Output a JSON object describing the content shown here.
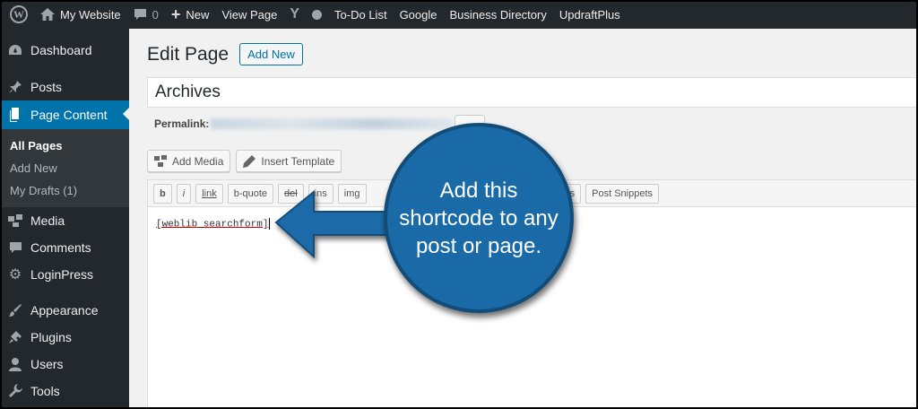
{
  "admin_bar": {
    "site_name": "My Website",
    "comments_count": "0",
    "new_label": "New",
    "view_page": "View Page",
    "links": [
      "To-Do List",
      "Google",
      "Business Directory",
      "UpdraftPlus"
    ]
  },
  "sidebar": {
    "items": [
      {
        "label": "Dashboard",
        "icon": "dashboard-icon"
      },
      {
        "label": "Posts",
        "icon": "pin-icon"
      },
      {
        "label": "Page Content",
        "icon": "pages-icon"
      }
    ],
    "submenu": [
      "All Pages",
      "Add New",
      "My Drafts (1)"
    ],
    "items_after": [
      {
        "label": "Media",
        "icon": "media-icon"
      },
      {
        "label": "Comments",
        "icon": "comment-icon"
      },
      {
        "label": "LoginPress",
        "icon": "gear-icon"
      },
      {
        "label": "Appearance",
        "icon": "brush-icon"
      },
      {
        "label": "Plugins",
        "icon": "plugin-icon"
      },
      {
        "label": "Users",
        "icon": "user-icon"
      },
      {
        "label": "Tools",
        "icon": "wrench-icon"
      }
    ]
  },
  "main": {
    "page_title": "Edit Page",
    "add_new": "Add New",
    "post_title": "Archives",
    "permalink_label": "Permalink:",
    "add_media": "Add Media",
    "insert_template": "Insert Template",
    "quicktags": [
      "b",
      "i",
      "link",
      "b-quote",
      "del",
      "ins",
      "img"
    ],
    "quicktags_tail": [
      "gs",
      "Post Snippets"
    ],
    "content": "[weblib_searchform]"
  },
  "callout": {
    "text": "Add this shortcode to any post or page."
  },
  "colors": {
    "admin_dark": "#23282d",
    "accent_blue": "#0073aa",
    "callout_blue": "#1a6aa7"
  }
}
